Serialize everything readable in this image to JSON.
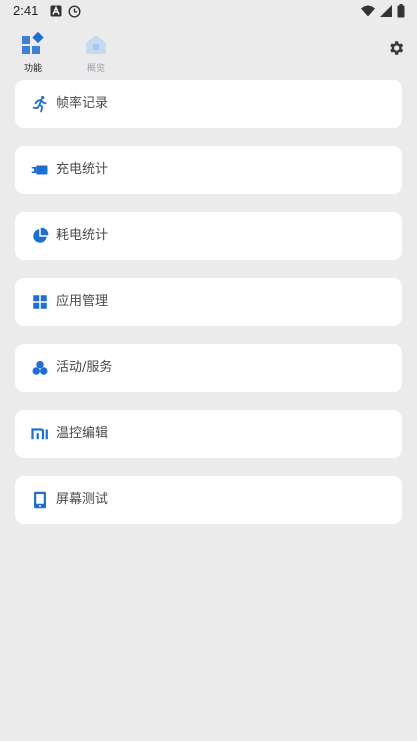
{
  "status_bar": {
    "time": "2:41"
  },
  "tabs": [
    {
      "label": "功能",
      "icon": "feature-grid-icon",
      "active": true
    },
    {
      "label": "概览",
      "icon": "house-icon",
      "active": false
    }
  ],
  "menu": [
    {
      "label": "帧率记录",
      "icon": "running-person-icon"
    },
    {
      "label": "充电统计",
      "icon": "charging-plug-icon"
    },
    {
      "label": "耗电统计",
      "icon": "pie-chart-icon"
    },
    {
      "label": "应用管理",
      "icon": "app-grid-icon"
    },
    {
      "label": "活动/服务",
      "icon": "activity-clover-icon"
    },
    {
      "label": "温控编辑",
      "icon": "mi-logo-icon"
    },
    {
      "label": "屏幕测试",
      "icon": "phone-screen-icon"
    }
  ],
  "colors": {
    "background": "#ebebeb",
    "card": "#ffffff",
    "accent": "#1e6fd0"
  }
}
